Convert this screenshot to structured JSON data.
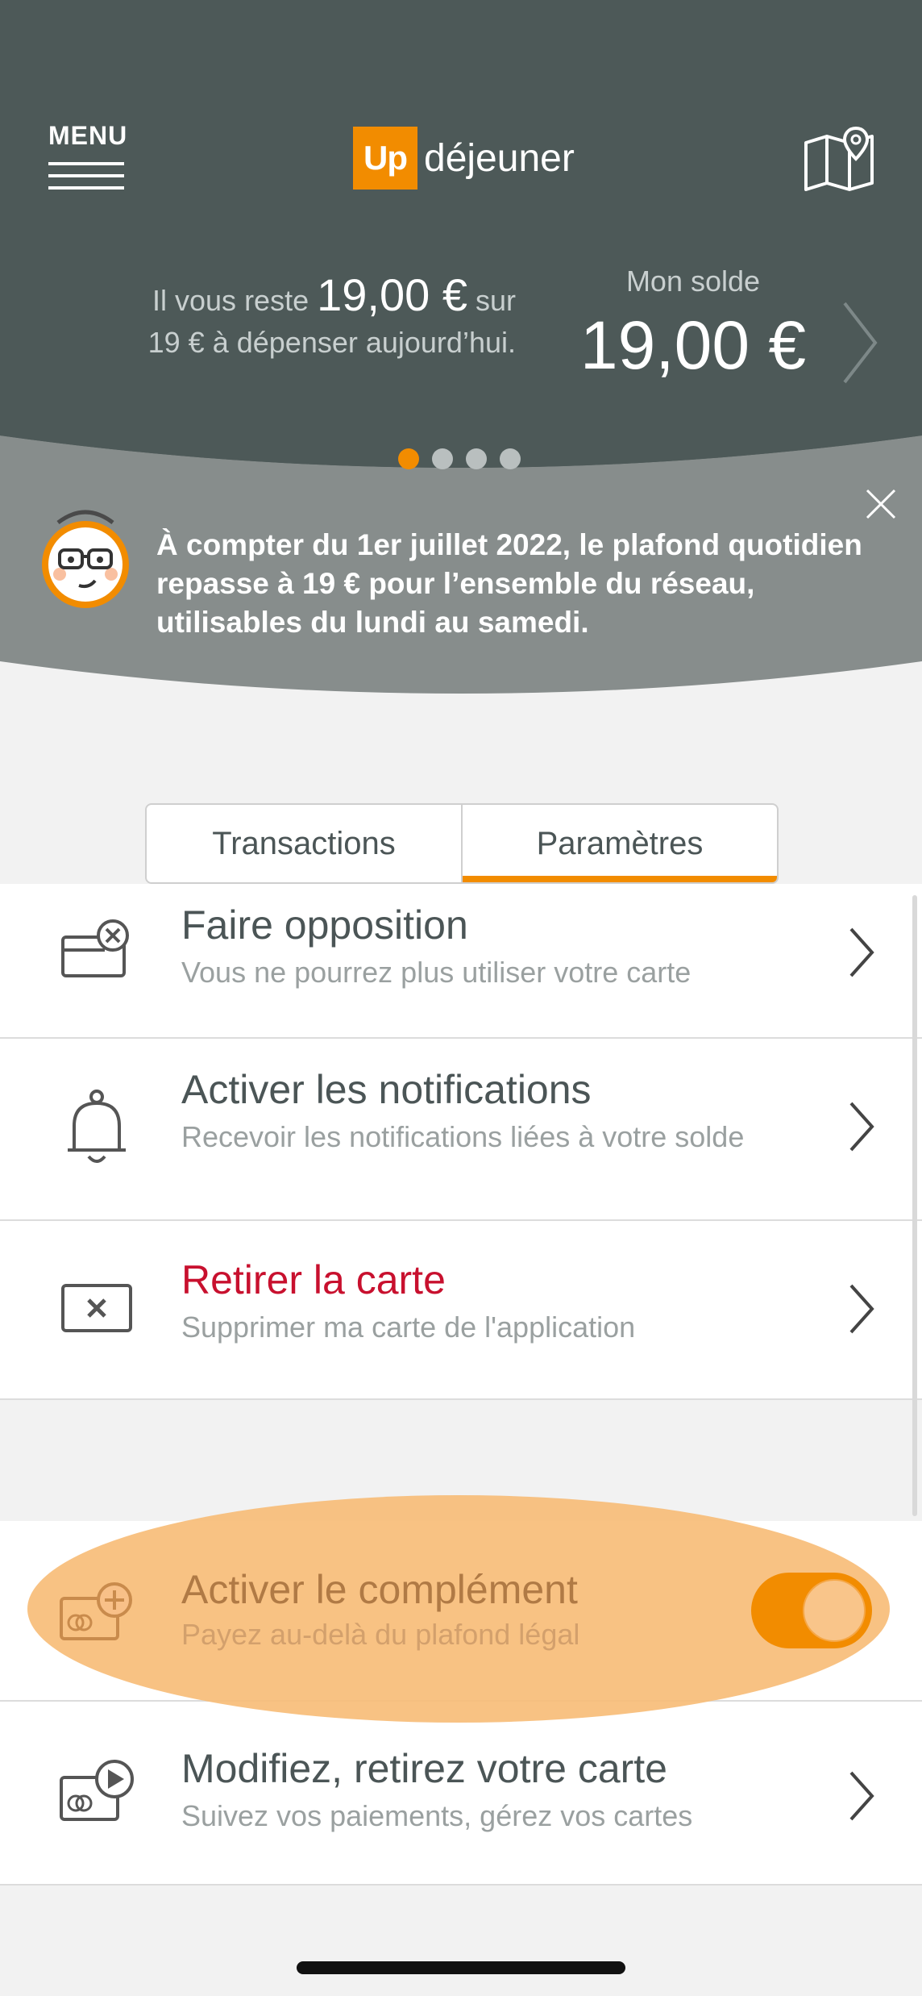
{
  "header": {
    "menu_label": "MENU",
    "logo_up": "Up",
    "logo_text": "déjeuner",
    "remaining_prefix": "Il vous reste",
    "remaining_amount": "19,00 €",
    "remaining_suffix": "sur",
    "remaining_line2": "19 € à dépenser aujourd’hui.",
    "balance_label": "Mon solde",
    "balance_value": "19,00 €",
    "pager": {
      "total": 4,
      "active": 1
    }
  },
  "banner": {
    "message": "À compter du 1er juillet 2022, le plafond quotidien repasse à 19 € pour l’ensemble du réseau, utilisables du lundi au samedi."
  },
  "tabs": [
    {
      "label": "Transactions",
      "active": false
    },
    {
      "label": "Paramètres",
      "active": true
    }
  ],
  "settings": [
    {
      "title": "Faire opposition",
      "subtitle": "Vous ne pourrez plus utiliser votre carte",
      "icon": "card-block-icon"
    },
    {
      "title": "Activer les notifications",
      "subtitle": "Recevoir les notifications liées à votre solde",
      "icon": "bell-icon"
    },
    {
      "title": "Retirer la carte",
      "subtitle": "Supprimer ma carte de l'application",
      "icon": "card-remove-icon"
    }
  ],
  "extras": [
    {
      "title": "Activer le complément",
      "subtitle": "Payez au-delà du plafond légal",
      "icon": "card-add-icon",
      "toggle_on": true
    },
    {
      "title": "Modifiez, retirez votre carte",
      "subtitle": "Suivez vos paiements, gérez vos cartes",
      "icon": "card-play-icon"
    }
  ],
  "colors": {
    "accent": "#f28c00",
    "header_bg": "#4d5958",
    "danger": "#c8102e"
  }
}
